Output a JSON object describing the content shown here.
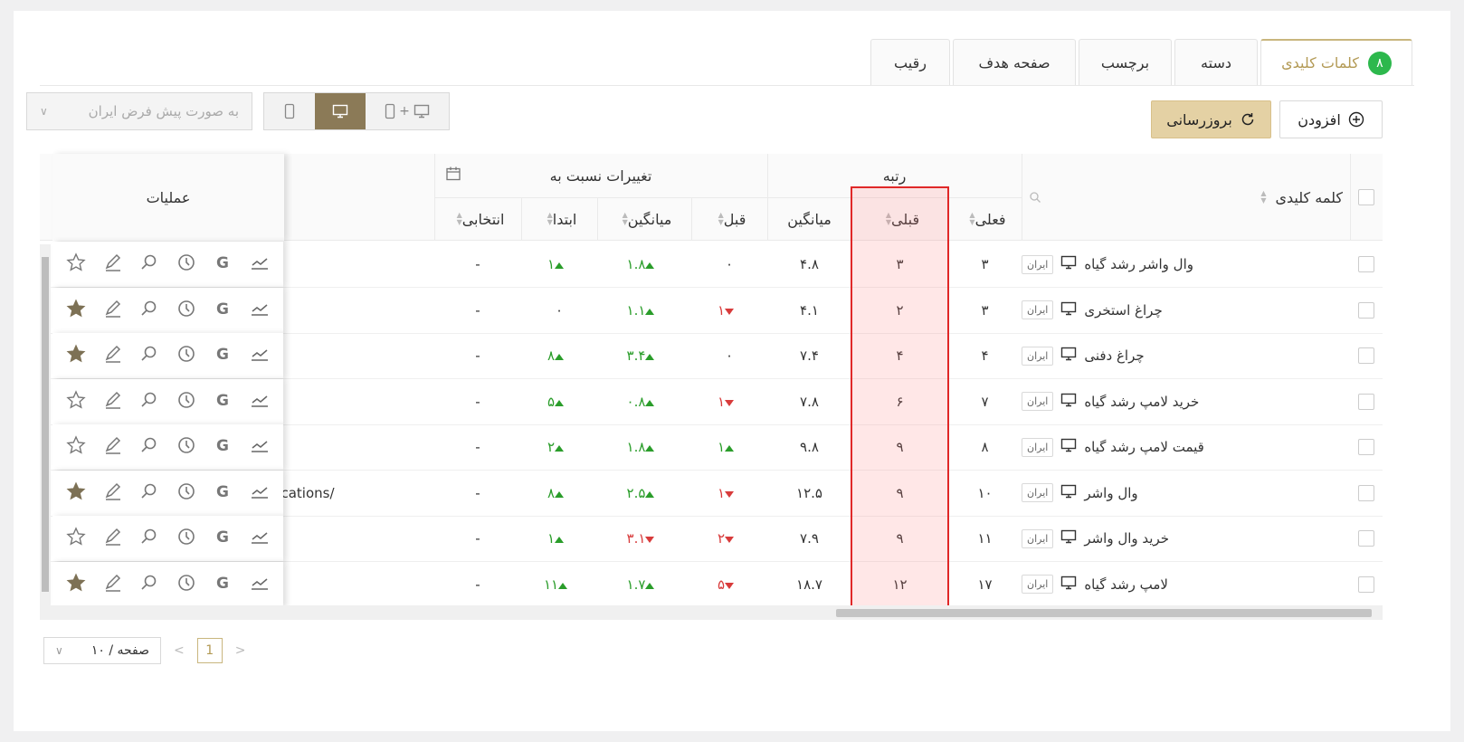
{
  "tabs": [
    {
      "label": "کلمات کلیدی",
      "badge": "۸",
      "active": true
    },
    {
      "label": "دسته"
    },
    {
      "label": "برچسب"
    },
    {
      "label": "صفحه هدف"
    },
    {
      "label": "رقیب"
    }
  ],
  "toolbar": {
    "add_label": "افزودن",
    "refresh_label": "بروزرسانی",
    "region_placeholder": "به صورت پیش فرض ایران",
    "device_plus": "+"
  },
  "table": {
    "headers": {
      "keyword": "کلمه کلیدی",
      "rank": "رتبه",
      "current": "فعلی",
      "previous": "قبلی",
      "average": "میانگین",
      "changes": "تغییرات نسبت به",
      "ch_prev": "قبل",
      "ch_avg": "میانگین",
      "ch_start": "ابتدا",
      "ch_custom": "انتخابی",
      "operations": "عملیات"
    },
    "url_fragment": "cations/",
    "rows": [
      {
        "keyword": "وال واشر رشد گیاه",
        "region": "ایران",
        "current": "۳",
        "previous": "۳",
        "average": "۴.۸",
        "ch_prev": "۰",
        "ch_prev_dir": "",
        "ch_avg": "۱.۸",
        "ch_avg_dir": "up",
        "ch_start": "۱",
        "ch_start_dir": "up",
        "ch_custom": "-",
        "starred": false
      },
      {
        "keyword": "چراغ استخری",
        "region": "ایران",
        "current": "۳",
        "previous": "۲",
        "average": "۴.۱",
        "ch_prev": "۱",
        "ch_prev_dir": "down",
        "ch_avg": "۱.۱",
        "ch_avg_dir": "up",
        "ch_start": "۰",
        "ch_start_dir": "",
        "ch_custom": "-",
        "starred": true
      },
      {
        "keyword": "چراغ دفنی",
        "region": "ایران",
        "current": "۴",
        "previous": "۴",
        "average": "۷.۴",
        "ch_prev": "۰",
        "ch_prev_dir": "",
        "ch_avg": "۳.۴",
        "ch_avg_dir": "up",
        "ch_start": "۸",
        "ch_start_dir": "up",
        "ch_custom": "-",
        "starred": true
      },
      {
        "keyword": "خرید لامپ رشد گیاه",
        "region": "ایران",
        "current": "۷",
        "previous": "۶",
        "average": "۷.۸",
        "ch_prev": "۱",
        "ch_prev_dir": "down",
        "ch_avg": "۰.۸",
        "ch_avg_dir": "up",
        "ch_start": "۵",
        "ch_start_dir": "up",
        "ch_custom": "-",
        "starred": false
      },
      {
        "keyword": "قیمت لامپ رشد گیاه",
        "region": "ایران",
        "current": "۸",
        "previous": "۹",
        "average": "۹.۸",
        "ch_prev": "۱",
        "ch_prev_dir": "up",
        "ch_avg": "۱.۸",
        "ch_avg_dir": "up",
        "ch_start": "۲",
        "ch_start_dir": "up",
        "ch_custom": "-",
        "starred": false
      },
      {
        "keyword": "وال واشر",
        "region": "ایران",
        "current": "۱۰",
        "previous": "۹",
        "average": "۱۲.۵",
        "ch_prev": "۱",
        "ch_prev_dir": "down",
        "ch_avg": "۲.۵",
        "ch_avg_dir": "up",
        "ch_start": "۸",
        "ch_start_dir": "up",
        "ch_custom": "-",
        "starred": true
      },
      {
        "keyword": "خرید وال واشر",
        "region": "ایران",
        "current": "۱۱",
        "previous": "۹",
        "average": "۷.۹",
        "ch_prev": "۲",
        "ch_prev_dir": "down",
        "ch_avg": "۳.۱",
        "ch_avg_dir": "down",
        "ch_start": "۱",
        "ch_start_dir": "up",
        "ch_custom": "-",
        "starred": false
      },
      {
        "keyword": "لامپ رشد گیاه",
        "region": "ایران",
        "current": "۱۷",
        "previous": "۱۲",
        "average": "۱۸.۷",
        "ch_prev": "۵",
        "ch_prev_dir": "down",
        "ch_avg": "۱.۷",
        "ch_avg_dir": "up",
        "ch_start": "۱۱",
        "ch_start_dir": "up",
        "ch_custom": "-",
        "starred": true
      }
    ]
  },
  "pagination": {
    "page_size": "۱۰ / صفحه",
    "current_page": "1"
  },
  "colors": {
    "accent": "#c9b67e",
    "badge_green": "#2db84d",
    "up_green": "#2a9d2a",
    "down_red": "#d83b3b",
    "highlight_red": "#e02828"
  }
}
